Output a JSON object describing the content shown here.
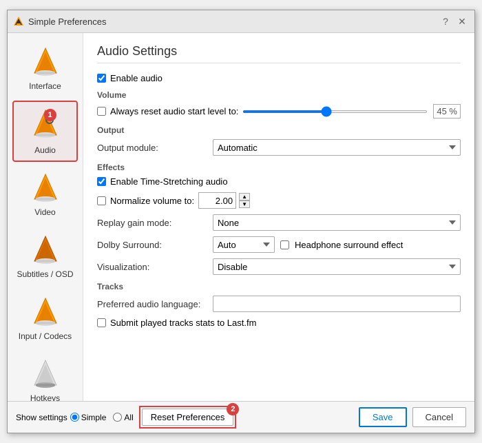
{
  "window": {
    "title": "Simple Preferences",
    "icon": "vlc-icon"
  },
  "sidebar": {
    "items": [
      {
        "id": "interface",
        "label": "Interface",
        "active": false
      },
      {
        "id": "audio",
        "label": "Audio",
        "active": true,
        "badge": "1"
      },
      {
        "id": "video",
        "label": "Video",
        "active": false
      },
      {
        "id": "subtitles",
        "label": "Subtitles / OSD",
        "active": false
      },
      {
        "id": "input",
        "label": "Input / Codecs",
        "active": false
      },
      {
        "id": "hotkeys",
        "label": "Hotkeys",
        "active": false
      }
    ]
  },
  "content": {
    "title": "Audio Settings",
    "enable_audio_label": "Enable audio",
    "volume_group": "Volume",
    "always_reset_label": "Always reset audio start level to:",
    "slider_value": "45 %",
    "output_group": "Output",
    "output_module_label": "Output module:",
    "output_module_value": "Automatic",
    "effects_group": "Effects",
    "time_stretch_label": "Enable Time-Stretching audio",
    "normalize_label": "Normalize volume to:",
    "normalize_value": "2.00",
    "replay_gain_label": "Replay gain mode:",
    "replay_gain_value": "None",
    "dolby_label": "Dolby Surround:",
    "dolby_value": "Auto",
    "headphone_label": "Headphone surround effect",
    "visualization_label": "Visualization:",
    "visualization_value": "Disable",
    "tracks_group": "Tracks",
    "preferred_lang_label": "Preferred audio language:",
    "preferred_lang_value": "",
    "submit_stats_label": "Submit played tracks stats to Last.fm"
  },
  "footer": {
    "show_settings_label": "Show settings",
    "simple_label": "Simple",
    "all_label": "All",
    "reset_label": "Reset Preferences",
    "save_label": "Save",
    "cancel_label": "Cancel",
    "reset_badge": "2"
  }
}
